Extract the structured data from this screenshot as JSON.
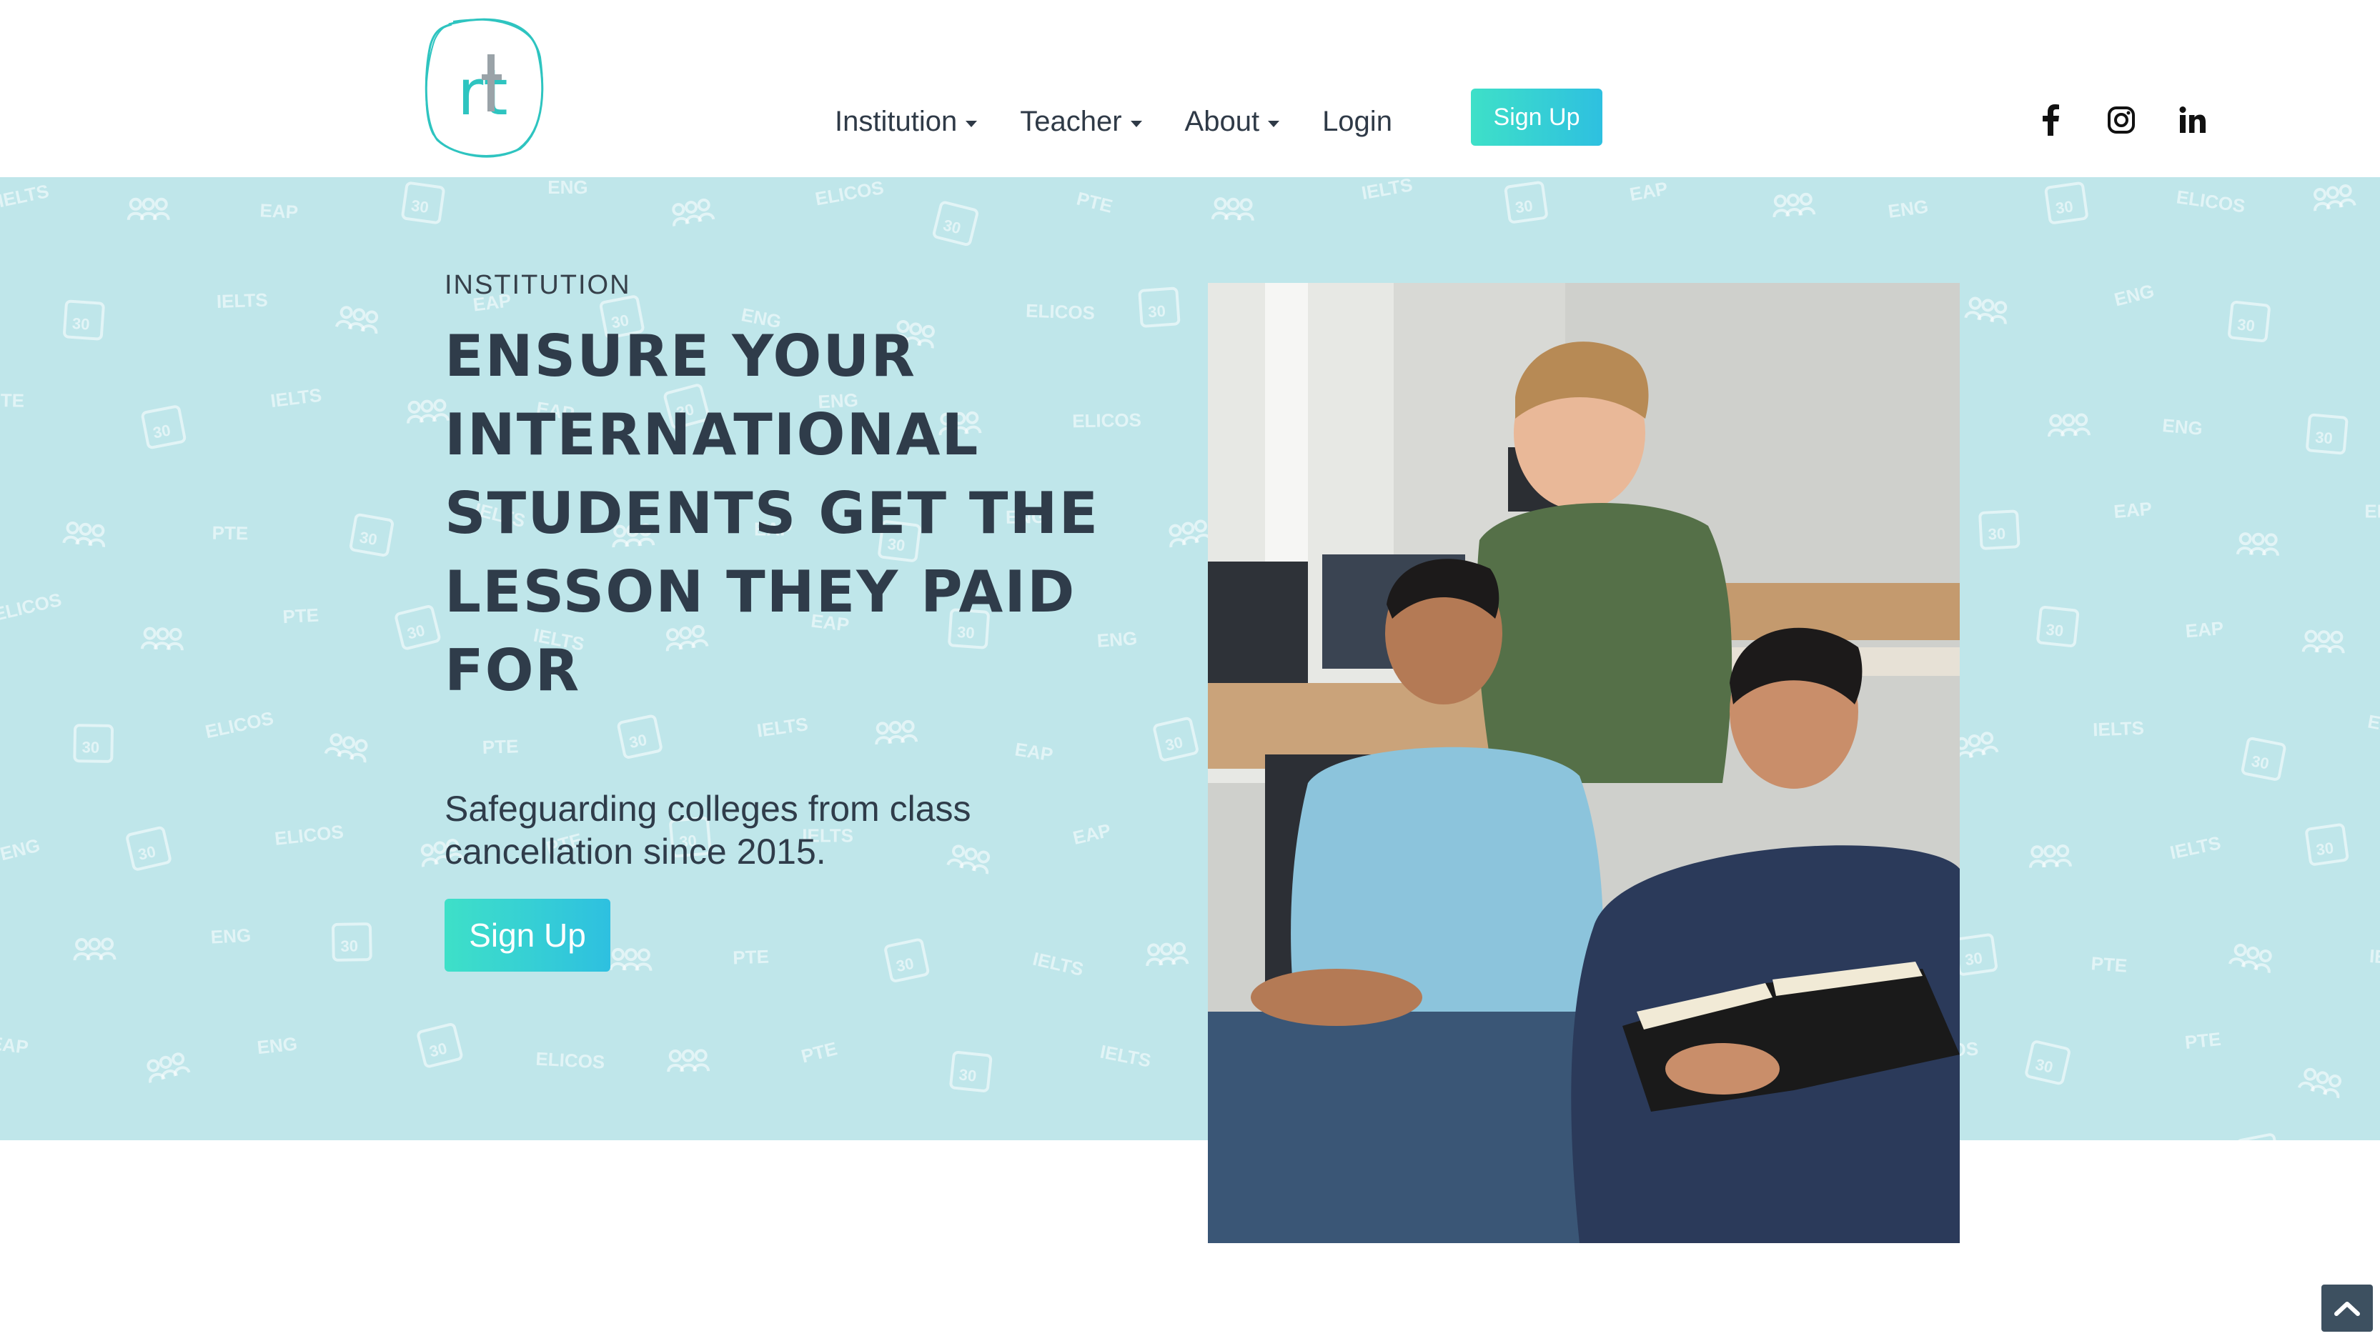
{
  "brand": {
    "logo_text": "rt",
    "accent": "#2ec4c0",
    "logo_gray": "#9aa3a8"
  },
  "nav": {
    "items": [
      {
        "label": "Institution",
        "dropdown": true
      },
      {
        "label": "Teacher",
        "dropdown": true
      },
      {
        "label": "About",
        "dropdown": true
      },
      {
        "label": "Login",
        "dropdown": false
      }
    ],
    "signup_label": "Sign Up"
  },
  "social": {
    "icons": [
      "facebook-icon",
      "instagram-icon",
      "linkedin-icon"
    ]
  },
  "hero": {
    "eyebrow": "INSTITUTION",
    "title_lines": [
      "ENSURE YOUR",
      "INTERNATIONAL",
      "STUDENTS GET THE",
      "LESSON THEY PAID",
      "FOR"
    ],
    "subtitle_lines": [
      "Safeguarding colleges from class",
      "cancellation since 2015."
    ],
    "cta_label": "Sign Up",
    "background": "#bfe6ea",
    "pattern_words": [
      "IELTS",
      "EAP",
      "ENG",
      "ELICOS",
      "PTE"
    ],
    "pattern_icon": "30"
  },
  "photo": {
    "subject": "three smiling students with a book"
  },
  "colors": {
    "heading": "#2f3c4a",
    "button_gradient_start": "#3ee0c8",
    "button_gradient_end": "#2ec0e0",
    "scroll_button": "#3d5060"
  }
}
